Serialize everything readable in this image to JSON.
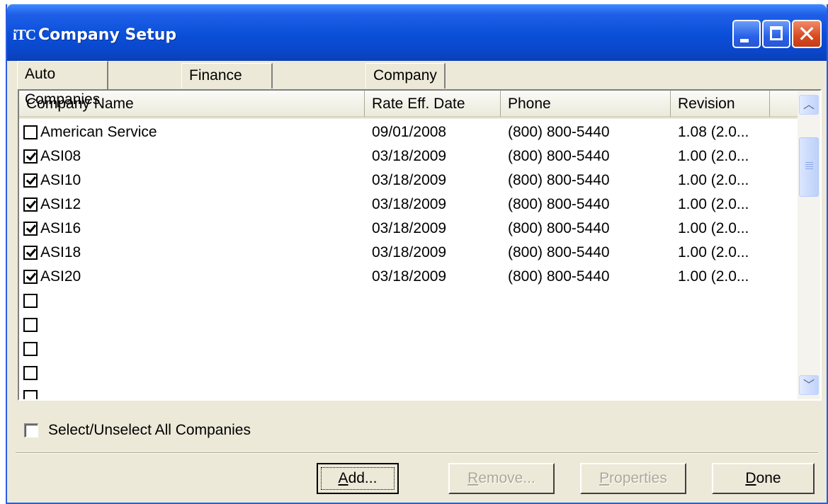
{
  "window": {
    "app_icon_text": "iTC",
    "title": "Company Setup"
  },
  "tabs": [
    {
      "label": "Auto Companies",
      "active": true
    },
    {
      "label": "Finance Companies",
      "active": false
    },
    {
      "label": "Company Groups",
      "active": false
    }
  ],
  "table": {
    "columns": [
      "Company Name",
      "Rate Eff. Date",
      "Phone",
      "Revision"
    ],
    "rows": [
      {
        "checked": false,
        "name": "American Service",
        "date": "09/01/2008",
        "phone": "(800) 800-5440",
        "revision": "1.08 (2.0..."
      },
      {
        "checked": true,
        "name": "ASI08",
        "date": "03/18/2009",
        "phone": "(800) 800-5440",
        "revision": "1.00 (2.0..."
      },
      {
        "checked": true,
        "name": "ASI10",
        "date": "03/18/2009",
        "phone": "(800) 800-5440",
        "revision": "1.00 (2.0..."
      },
      {
        "checked": true,
        "name": "ASI12",
        "date": "03/18/2009",
        "phone": "(800) 800-5440",
        "revision": "1.00 (2.0..."
      },
      {
        "checked": true,
        "name": "ASI16",
        "date": "03/18/2009",
        "phone": "(800) 800-5440",
        "revision": "1.00 (2.0..."
      },
      {
        "checked": true,
        "name": "ASI18",
        "date": "03/18/2009",
        "phone": "(800) 800-5440",
        "revision": "1.00 (2.0..."
      },
      {
        "checked": true,
        "name": "ASI20",
        "date": "03/18/2009",
        "phone": "(800) 800-5440",
        "revision": "1.00 (2.0..."
      },
      {
        "checked": false,
        "name": "",
        "date": "",
        "phone": "",
        "revision": ""
      },
      {
        "checked": false,
        "name": "",
        "date": "",
        "phone": "",
        "revision": ""
      },
      {
        "checked": false,
        "name": "",
        "date": "",
        "phone": "",
        "revision": ""
      },
      {
        "checked": false,
        "name": "",
        "date": "",
        "phone": "",
        "revision": ""
      },
      {
        "checked": false,
        "name": "",
        "date": "",
        "phone": "",
        "revision": ""
      }
    ]
  },
  "select_all": {
    "label": "Select/Unselect All Companies",
    "checked": false
  },
  "buttons": {
    "add": {
      "label": "Add...",
      "accel": "A",
      "rest": "dd...",
      "enabled": true
    },
    "remove": {
      "label": "Remove...",
      "accel": "R",
      "rest": "emove...",
      "enabled": false
    },
    "properties": {
      "label": "Properties",
      "accel": "P",
      "rest": "roperties",
      "enabled": false
    },
    "done": {
      "label": "Done",
      "accel": "D",
      "rest": "one",
      "enabled": true
    }
  },
  "icons": {
    "minimize": "minimize-icon",
    "maximize": "maximize-icon",
    "close": "close-icon",
    "scroll_up": "chevron-up-icon",
    "scroll_down": "chevron-down-icon"
  },
  "colors": {
    "titlebar": "#0a4fd8",
    "window_bg": "#ece9d8",
    "close_button": "#d84a20"
  }
}
